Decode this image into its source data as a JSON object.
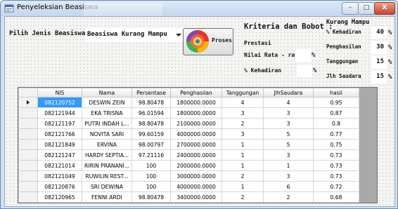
{
  "window": {
    "title": "Penyeleksian Beasiswa",
    "minimize": "–",
    "maximize": "□",
    "close": "X"
  },
  "form": {
    "jenis_label": "Pilih Jenis Beasiswa",
    "jenis_value": "Beasiswa Kurang Mampu",
    "proses_label": "Proses",
    "kriteria_title": "Kriteria dan Bobot :",
    "prestasi_label": "Prestasi",
    "nilai_label": "Nilai Rata - rata",
    "nilai_pct": "%",
    "kehadiran_label": "% Kehadiran",
    "kehadiran_pct": "%",
    "km_title": "Kurang Mampu",
    "km_items": [
      {
        "label": "% Kehadiran",
        "value": "40",
        "pct": "%"
      },
      {
        "label": "Penghasilan",
        "value": "30",
        "pct": "%"
      },
      {
        "label": "Tanggungan",
        "value": "15",
        "pct": "%"
      },
      {
        "label": "Jlh Saudara",
        "value": "15",
        "pct": "%"
      }
    ]
  },
  "table": {
    "columns": [
      "NIS",
      "Nama",
      "Persentase",
      "Penghasilan",
      "Tanggungan",
      "JlhSaudara",
      "hasil"
    ],
    "rows": [
      [
        "082120752",
        "DESWIN ZEIN",
        "98.80478",
        "1800000.0000",
        "4",
        "4",
        "0.95"
      ],
      [
        "082121944",
        "EKA TRISNA",
        "96.01594",
        "1800000.0000",
        "3",
        "3",
        "0.87"
      ],
      [
        "082121197",
        "PUTRI INDAH L...",
        "98.80478",
        "2100000.0000",
        "2",
        "3",
        "0.8"
      ],
      [
        "082121766",
        "NOVITA SARI",
        "99.60159",
        "4000000.0000",
        "3",
        "5",
        "0.77"
      ],
      [
        "082121849",
        "ERVINA",
        "98.00797",
        "2700000.0000",
        "1",
        "5",
        "0.75"
      ],
      [
        "082121247",
        "HARDY SEPTIA...",
        "97.21116",
        "2400000.0000",
        "1",
        "3",
        "0.73"
      ],
      [
        "082121014",
        "RIRIN PRANANI...",
        "100",
        "2000000.0000",
        "1",
        "1",
        "0.73"
      ],
      [
        "082121049",
        "RUWILIN REST...",
        "100",
        "3000000.0000",
        "2",
        "3",
        "0.73"
      ],
      [
        "082120876",
        "SRI DEWINA",
        "100",
        "4000000.0000",
        "1",
        "6",
        "0.72"
      ],
      [
        "082120965",
        "FENNI ARDI",
        "98.80478",
        "3400000.0000",
        "2",
        "2",
        "0.68"
      ]
    ]
  },
  "colors": {
    "selection": "#3399ff",
    "grid_background": "#a9a9a9"
  },
  "icons": {
    "app": "window-app-icon",
    "proses": "colorful-spiral-icon",
    "current_row": "triangle-right-icon"
  }
}
